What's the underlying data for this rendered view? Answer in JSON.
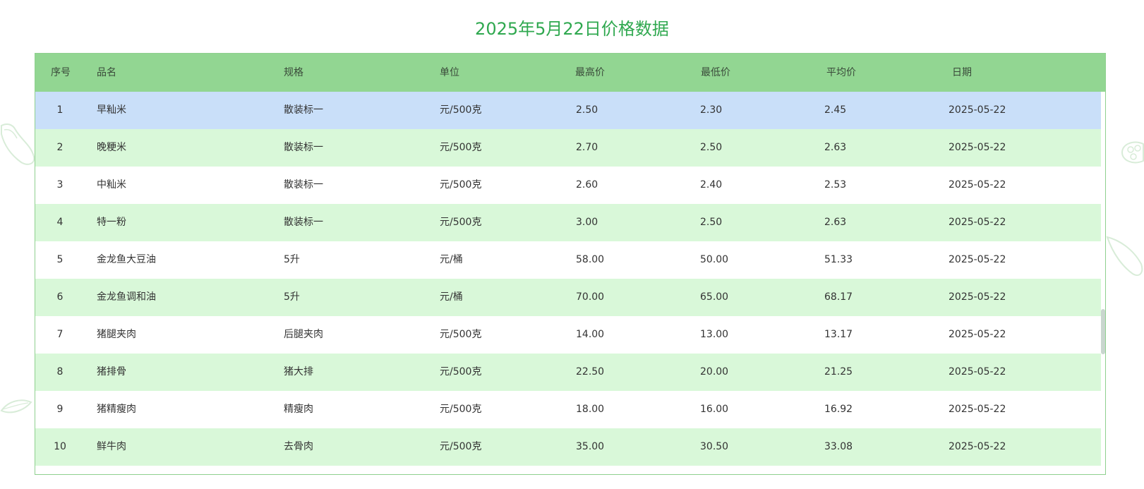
{
  "page": {
    "title": "2025年5月22日价格数据"
  },
  "colors": {
    "title": "#2fa84f",
    "header_bg": "#92d692",
    "row_alt_bg": "#d9f8d9",
    "row_selected_bg": "#c9dff9",
    "border": "#8fd08f"
  },
  "table": {
    "headers": [
      "序号",
      "品名",
      "规格",
      "单位",
      "最高价",
      "最低价",
      "平均价",
      "日期"
    ],
    "selected_row": 0,
    "rows": [
      {
        "no": "1",
        "name": "早籼米",
        "spec": "散装标一",
        "unit": "元/500克",
        "high": "2.50",
        "low": "2.30",
        "avg": "2.45",
        "date": "2025-05-22"
      },
      {
        "no": "2",
        "name": "晚粳米",
        "spec": "散装标一",
        "unit": "元/500克",
        "high": "2.70",
        "low": "2.50",
        "avg": "2.63",
        "date": "2025-05-22"
      },
      {
        "no": "3",
        "name": "中籼米",
        "spec": "散装标一",
        "unit": "元/500克",
        "high": "2.60",
        "low": "2.40",
        "avg": "2.53",
        "date": "2025-05-22"
      },
      {
        "no": "4",
        "name": "特一粉",
        "spec": "散装标一",
        "unit": "元/500克",
        "high": "3.00",
        "low": "2.50",
        "avg": "2.63",
        "date": "2025-05-22"
      },
      {
        "no": "5",
        "name": "金龙鱼大豆油",
        "spec": "5升",
        "unit": "元/桶",
        "high": "58.00",
        "low": "50.00",
        "avg": "51.33",
        "date": "2025-05-22"
      },
      {
        "no": "6",
        "name": "金龙鱼调和油",
        "spec": "5升",
        "unit": "元/桶",
        "high": "70.00",
        "low": "65.00",
        "avg": "68.17",
        "date": "2025-05-22"
      },
      {
        "no": "7",
        "name": "猪腿夹肉",
        "spec": "后腿夹肉",
        "unit": "元/500克",
        "high": "14.00",
        "low": "13.00",
        "avg": "13.17",
        "date": "2025-05-22"
      },
      {
        "no": "8",
        "name": "猪排骨",
        "spec": "猪大排",
        "unit": "元/500克",
        "high": "22.50",
        "low": "20.00",
        "avg": "21.25",
        "date": "2025-05-22"
      },
      {
        "no": "9",
        "name": "猪精瘦肉",
        "spec": "精瘦肉",
        "unit": "元/500克",
        "high": "18.00",
        "low": "16.00",
        "avg": "16.92",
        "date": "2025-05-22"
      },
      {
        "no": "10",
        "name": "鲜牛肉",
        "spec": "去骨肉",
        "unit": "元/500克",
        "high": "35.00",
        "low": "30.50",
        "avg": "33.08",
        "date": "2025-05-22"
      }
    ]
  }
}
